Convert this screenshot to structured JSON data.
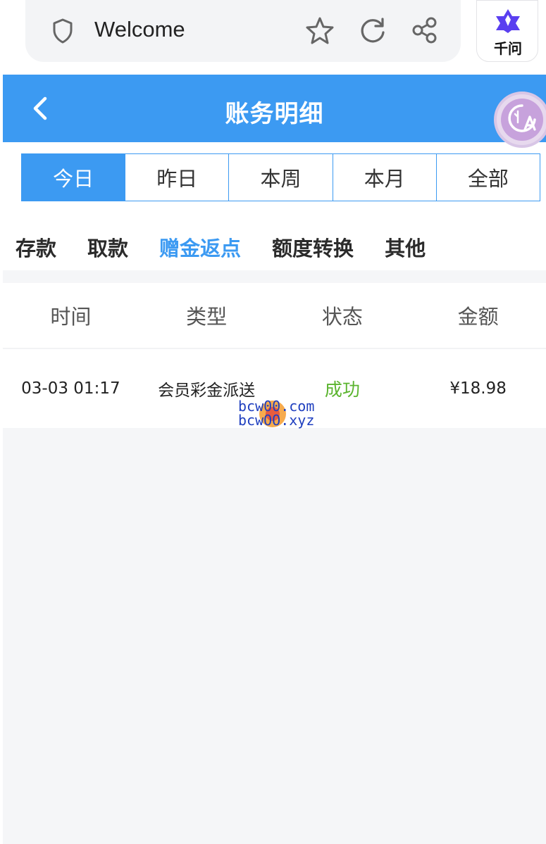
{
  "browser": {
    "title": "Welcome",
    "assistant_label": "千问"
  },
  "header": {
    "title": "账务明细"
  },
  "period_tabs": [
    {
      "label": "今日",
      "active": true
    },
    {
      "label": "昨日",
      "active": false
    },
    {
      "label": "本周",
      "active": false
    },
    {
      "label": "本月",
      "active": false
    },
    {
      "label": "全部",
      "active": false
    }
  ],
  "category_tabs": [
    {
      "label": "存款",
      "active": false
    },
    {
      "label": "取款",
      "active": false
    },
    {
      "label": "赠金返点",
      "active": true
    },
    {
      "label": "额度转换",
      "active": false
    },
    {
      "label": "其他",
      "active": false
    }
  ],
  "table": {
    "columns": [
      "时间",
      "类型",
      "状态",
      "金额"
    ],
    "rows": [
      {
        "time": "03-03 01:17",
        "type": "会员彩金派送",
        "status": "成功",
        "amount": "¥18.98"
      }
    ]
  },
  "watermark": {
    "line1": "bcw00.com",
    "line2": "bcwOO.xyz"
  },
  "colors": {
    "primary": "#3c9af2",
    "success": "#5bb42f",
    "background": "#f5f6f8"
  },
  "icons": [
    "shield-icon",
    "star-icon",
    "reload-icon",
    "share-icon",
    "qianwen-logo-icon",
    "back-icon",
    "translate-icon"
  ]
}
